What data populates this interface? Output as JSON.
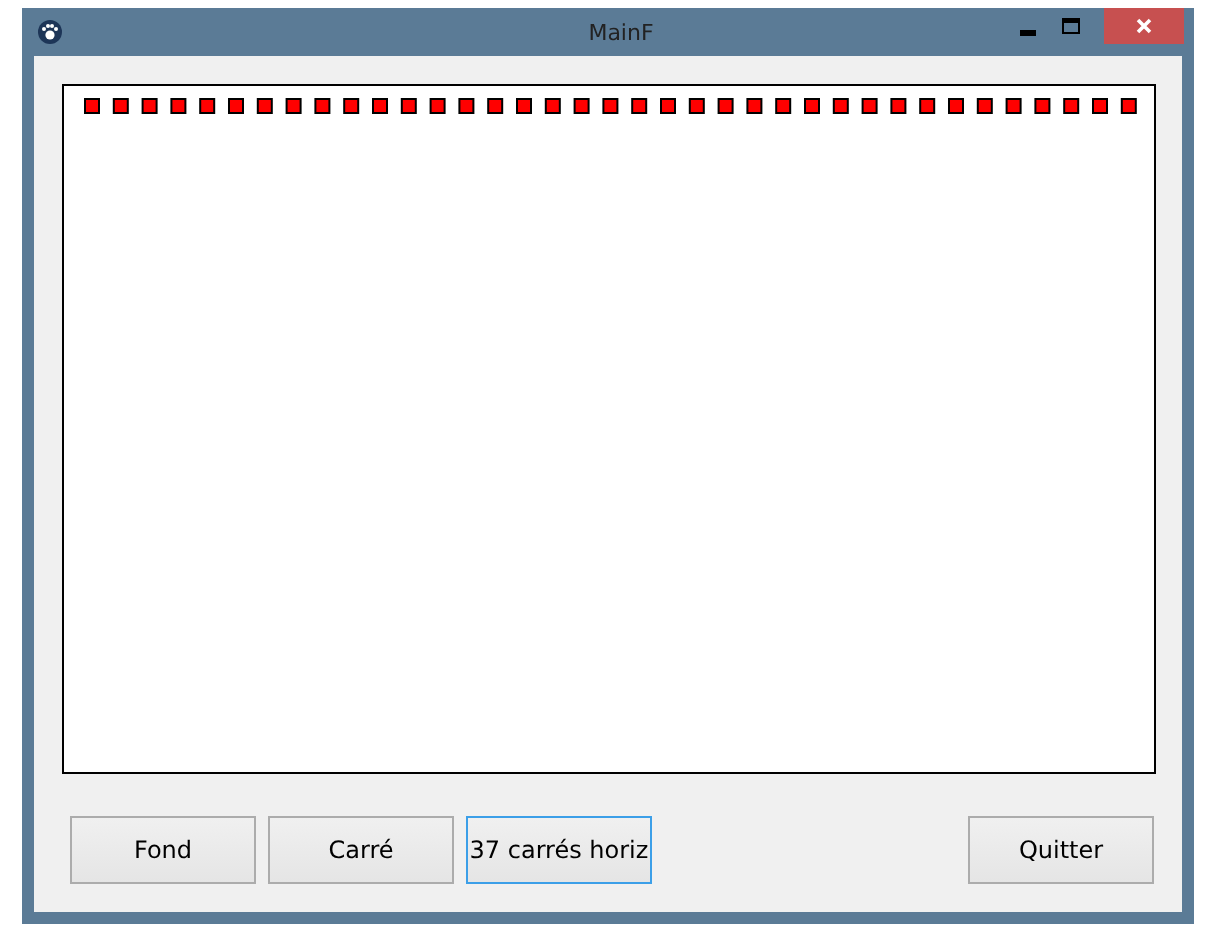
{
  "window": {
    "title": "MainF"
  },
  "buttons": [
    {
      "label": "Fond",
      "focused": false
    },
    {
      "label": "Carré",
      "focused": false
    },
    {
      "label": "37 carrés horiz",
      "focused": true
    },
    {
      "label": "Quitter",
      "focused": false
    }
  ]
}
